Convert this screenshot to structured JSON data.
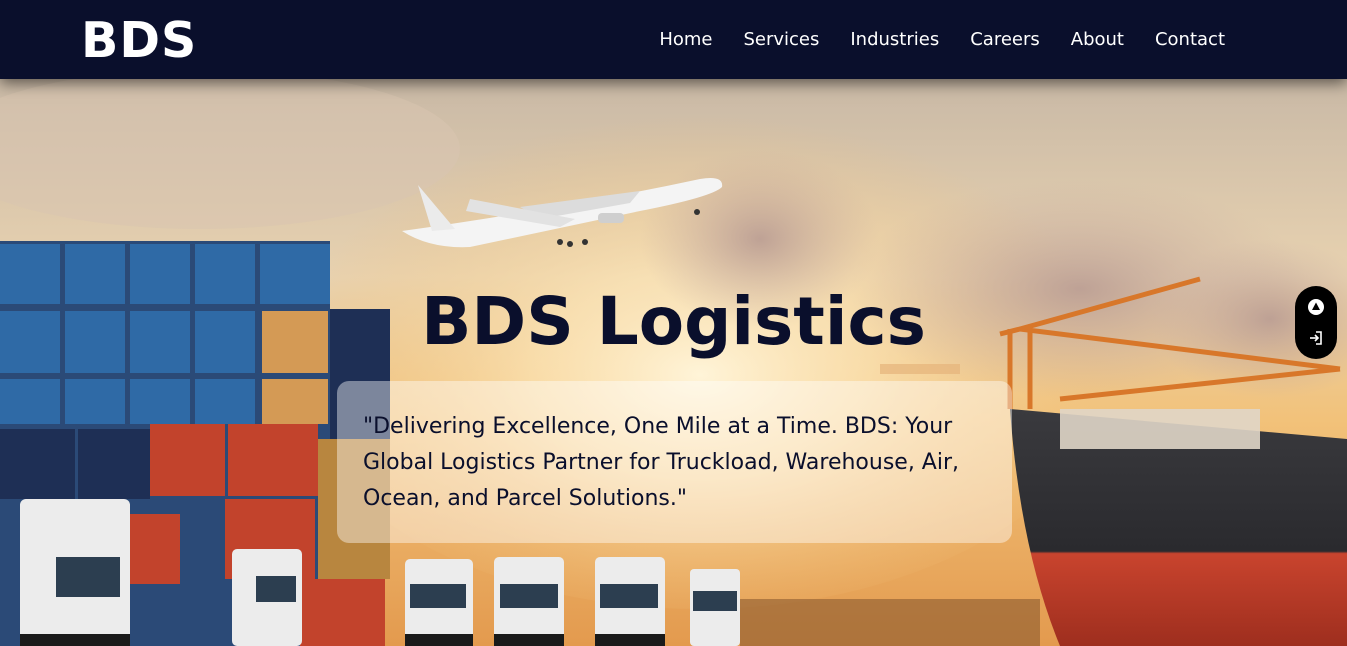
{
  "brand": {
    "logo": "BDS"
  },
  "nav": {
    "items": [
      "Home",
      "Services",
      "Industries",
      "Careers",
      "About",
      "Contact"
    ]
  },
  "hero": {
    "title_bold": "BDS",
    "title_rest": " Logistics",
    "tagline": "\"Delivering Excellence, One Mile at a Time. BDS: Your Global Logistics Partner for Truckload, Warehouse, Air, Ocean, and Parcel Solutions.\""
  },
  "side_widget": {
    "icons": [
      "triangle-up-icon",
      "sign-in-icon"
    ]
  },
  "colors": {
    "navy": "#0a0f2c",
    "white": "#ffffff"
  }
}
